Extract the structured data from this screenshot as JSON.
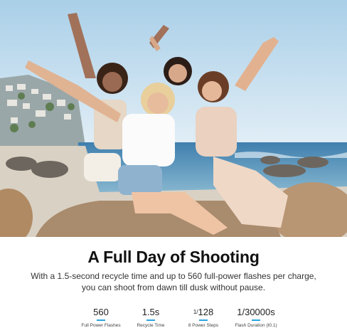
{
  "hero": {
    "image_alt": "Four women sitting on a rock at the beach with arms raised"
  },
  "headline": "A Full Day of Shooting",
  "subtext": "With a 1.5-second recycle time and up to 560 full-power flashes per charge, you can shoot from dawn till dusk without pause.",
  "specs": [
    {
      "value": "560",
      "label": "Full Power Flashes"
    },
    {
      "value": "1.5s",
      "label": "Recycle Time"
    },
    {
      "value_sup": "1/",
      "value": "128",
      "label": "8 Power Steps"
    },
    {
      "value": "1/30000s",
      "label": "Flash Duration (t0.1)"
    }
  ],
  "colors": {
    "accent": "#2ba3e0",
    "sky": "#bcd9ee",
    "sea": "#4f8fb8"
  }
}
